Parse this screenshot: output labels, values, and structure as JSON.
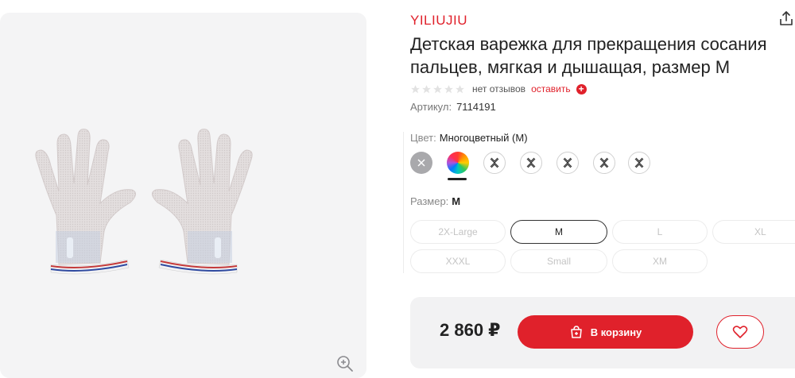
{
  "product": {
    "brand": "YILIUJIU",
    "title_line1": "Детская варежка для прекращения сосания",
    "title_line2": "пальцев, мягкая и дышащая, размер M",
    "reviews_text": "нет отзывов",
    "leave_review": "оставить",
    "rating": 0,
    "rating_max": 5,
    "sku_label": "Артикул:",
    "sku_value": "7114191"
  },
  "color": {
    "label": "Цвет:",
    "selected": "Многоцветный (M)",
    "swatches": [
      {
        "kind": "unavailable-gray",
        "icon": "close-icon"
      },
      {
        "kind": "rainbow-selected",
        "icon": "color-wheel-icon"
      },
      {
        "kind": "unavailable",
        "icon": "crossed-out-icon"
      },
      {
        "kind": "unavailable",
        "icon": "crossed-out-icon"
      },
      {
        "kind": "unavailable",
        "icon": "crossed-out-icon"
      },
      {
        "kind": "unavailable",
        "icon": "crossed-out-icon"
      },
      {
        "kind": "unavailable",
        "icon": "crossed-out-icon"
      }
    ]
  },
  "size": {
    "label": "Размер:",
    "selected": "M",
    "options": [
      "2X-Large",
      "M",
      "L",
      "XL",
      "XXXL",
      "Small",
      "XM"
    ]
  },
  "purchase": {
    "price": "2 860 ₽",
    "add_to_cart": "В корзину"
  },
  "icons": {
    "zoom": "zoom-in-icon",
    "share": "share-icon",
    "cart": "shopping-bag-plus-icon",
    "favorite": "heart-icon"
  },
  "colors": {
    "accent": "#e0212b",
    "panel": "#f2f2f3",
    "gallery_bg": "#f4f4f5"
  }
}
